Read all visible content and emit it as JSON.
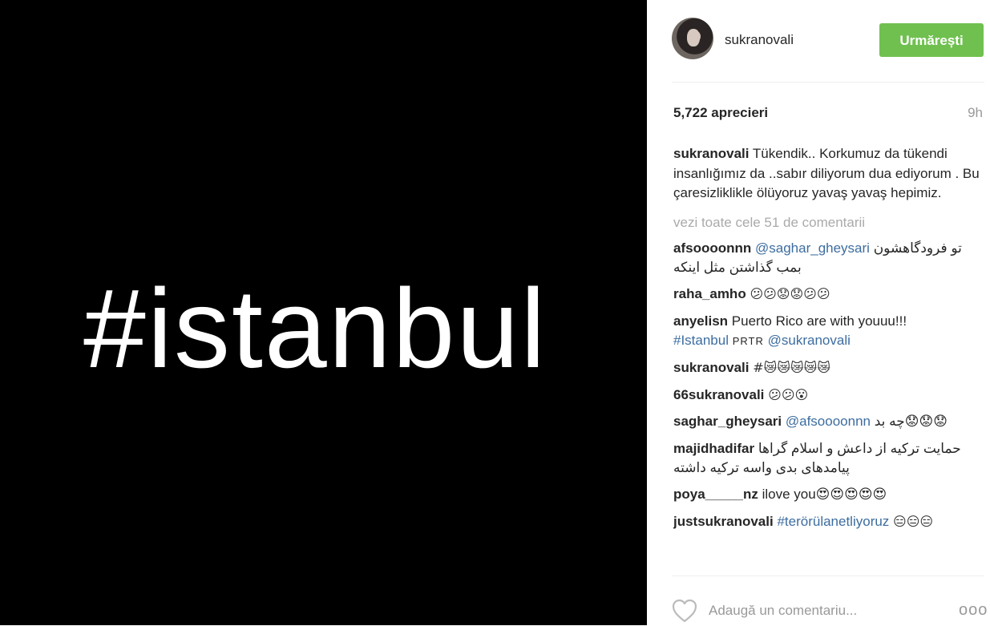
{
  "media": {
    "text": "#istanbul"
  },
  "header": {
    "username": "sukranovali",
    "follow_label": "Urmărești"
  },
  "stats": {
    "likes": "5,722 aprecieri",
    "time": "9h"
  },
  "caption": {
    "username": "sukranovali",
    "text": "Tükendik.. Korkumuz da tükendi insanlığımız da ..sabır diliyorum dua ediyorum . Bu çaresizliklikle ölüyoruz yavaş yavaş hepimiz."
  },
  "view_all": "vezi toate cele 51 de comentarii",
  "comments": [
    {
      "username": "afsoooonnn",
      "mention": "@saghar_gheysari",
      "text": "تو فرودگاهشون بمب گذاشتن مثل اینکه"
    },
    {
      "username": "raha_amho",
      "text": "😕😕😟😟😕😕"
    },
    {
      "username": "anyelisn",
      "text": "Puerto Rico are with youuu!!!",
      "hashtag": "#Istanbul",
      "extra": "PRTR",
      "mention": "@sukranovali"
    },
    {
      "username": "sukranovali",
      "hashtag": "#😿😿😿😿😿"
    },
    {
      "username": "66sukranovali",
      "text": "😕😕😮"
    },
    {
      "username": "saghar_gheysari",
      "mention": "@afsoooonnn",
      "text": "چه بد😟😟😟"
    },
    {
      "username": "majidhadifar",
      "text": "حمایت ترکیه از داعش و اسلام گراها پیامدهای بدی واسه ترکیه داشته"
    },
    {
      "username": "poya_____nz",
      "text": "ilove you😍😍😍😍😍"
    },
    {
      "username": "justsukranovali",
      "hashtag": "#terörülanetliyoruz",
      "text": "😑😑😑"
    }
  ],
  "footer": {
    "placeholder": "Adaugă un comentariu...",
    "more_label": "ooo"
  },
  "colors": {
    "follow_button": "#70c050",
    "link": "#3d6da0",
    "muted": "#999999",
    "media_bg": "#000000"
  }
}
